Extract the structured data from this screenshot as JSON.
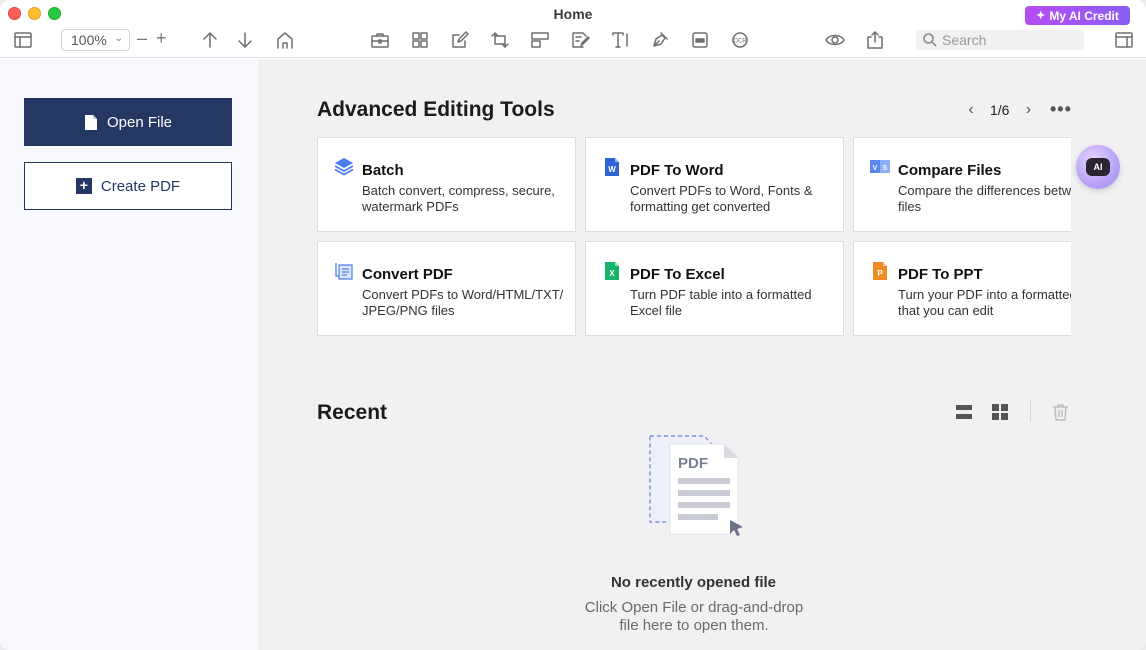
{
  "window": {
    "title": "Home"
  },
  "toolbar": {
    "credit_label": "My AI Credit",
    "zoom_value": "100%",
    "search_placeholder": "Search"
  },
  "sidebar": {
    "open_file": "Open File",
    "create_pdf": "Create PDF"
  },
  "tools": {
    "title": "Advanced Editing Tools",
    "page_indicator": "1/6",
    "cards": [
      {
        "icon": "batch-icon",
        "title": "Batch",
        "desc": "Batch convert, compress, secure, watermark PDFs"
      },
      {
        "icon": "word-icon",
        "title": "PDF To Word",
        "desc": "Convert PDFs to Word, Fonts & formatting get converted"
      },
      {
        "icon": "compare-icon",
        "title": "Compare Files",
        "desc": "Compare the differences between two files"
      },
      {
        "icon": "convert-icon",
        "title": "Convert PDF",
        "desc": "Convert PDFs to Word/HTML/TXT/ JPEG/PNG files"
      },
      {
        "icon": "excel-icon",
        "title": "PDF To Excel",
        "desc": "Turn PDF table into a formatted Excel file"
      },
      {
        "icon": "ppt-icon",
        "title": "PDF To PPT",
        "desc": "Turn your PDF into a formatted PPT file that you can edit"
      }
    ]
  },
  "recent": {
    "title": "Recent",
    "empty_title": "No recently opened file",
    "empty_subtitle": "Click Open File or drag-and-drop file here to open them.",
    "illustration_label": "PDF"
  },
  "colors": {
    "accent": "#243863",
    "credit_gradient_start": "#b64df2",
    "credit_gradient_end": "#8b5cf6"
  }
}
